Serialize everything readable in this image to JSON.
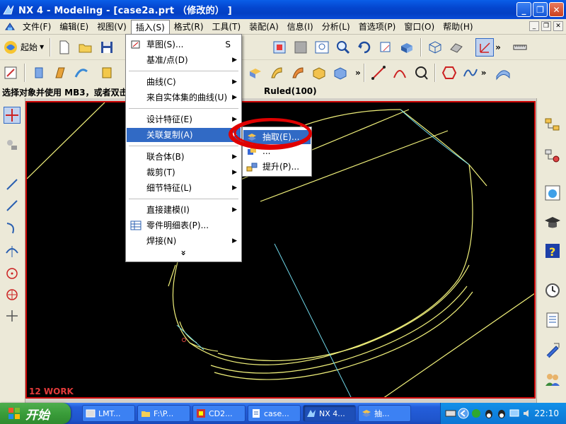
{
  "window": {
    "title": "NX 4 - Modeling - [case2a.prt （修改的） ]",
    "minimize": "_",
    "restore": "❐",
    "close": "✕"
  },
  "menubar": {
    "items": [
      "文件(F)",
      "编辑(E)",
      "视图(V)",
      "插入(S)",
      "格式(R)",
      "工具(T)",
      "装配(A)",
      "信息(I)",
      "分析(L)",
      "首选项(P)",
      "窗口(O)",
      "帮助(H)"
    ],
    "active_index": 3,
    "mdi": [
      "_",
      "❐",
      "✕"
    ]
  },
  "toolbar": {
    "start_label": "起始",
    "more_glyph": "»"
  },
  "prompt": {
    "text": "选择对象并使用 MB3，或者双击",
    "status": "Ruled(100)"
  },
  "insert_menu": {
    "items": [
      {
        "label": "草图(S)...",
        "shortcut": "S",
        "submenu": false,
        "icon": "sketch-icon"
      },
      {
        "label": "基准/点(D)",
        "shortcut": "",
        "submenu": true,
        "icon": ""
      },
      {
        "label": "曲线(C)",
        "shortcut": "",
        "submenu": true,
        "icon": ""
      },
      {
        "label": "来自实体集的曲线(U)",
        "shortcut": "",
        "submenu": true,
        "icon": ""
      },
      {
        "label": "设计特征(E)",
        "shortcut": "",
        "submenu": true,
        "icon": ""
      },
      {
        "label": "关联复制(A)",
        "shortcut": "",
        "submenu": true,
        "icon": ""
      },
      {
        "label": "联合体(B)",
        "shortcut": "",
        "submenu": true,
        "icon": ""
      },
      {
        "label": "裁剪(T)",
        "shortcut": "",
        "submenu": true,
        "icon": ""
      },
      {
        "label": "细节特征(L)",
        "shortcut": "",
        "submenu": true,
        "icon": ""
      },
      {
        "label": "直接建模(I)",
        "shortcut": "",
        "submenu": true,
        "icon": ""
      },
      {
        "label": "零件明细表(P)...",
        "shortcut": "",
        "submenu": false,
        "icon": "parts-list-icon"
      },
      {
        "label": "焊接(N)",
        "shortcut": "",
        "submenu": true,
        "icon": ""
      }
    ],
    "highlighted_index": 5,
    "more": "»",
    "submenu_arrow": "▶"
  },
  "associative_copy_submenu": {
    "items": [
      {
        "label": "抽取(E)...",
        "icon": "extract-icon"
      },
      {
        "label": "...",
        "icon": "instance-icon"
      },
      {
        "label": "提升(P)...",
        "icon": "promote-icon"
      }
    ],
    "highlighted_index": 0
  },
  "viewport": {
    "work_layer": "12 WORK",
    "background": "#000000",
    "curve_color": "#f0f07a",
    "edge_color": "#6fd6e8"
  },
  "taskbar": {
    "start_label": "开始",
    "tasks": [
      {
        "label": "LMT...",
        "active": false
      },
      {
        "label": "F:\\P...",
        "active": false
      },
      {
        "label": "CD2...",
        "active": false
      },
      {
        "label": "case...",
        "active": false
      },
      {
        "label": "NX 4...",
        "active": true
      },
      {
        "label": "抽...",
        "active": false
      }
    ],
    "clock": "22:10"
  },
  "colors": {
    "highlight": "#316ac5",
    "annotation_red": "#e00000",
    "titlebar": "#0446cf",
    "taskbar": "#245edb"
  }
}
